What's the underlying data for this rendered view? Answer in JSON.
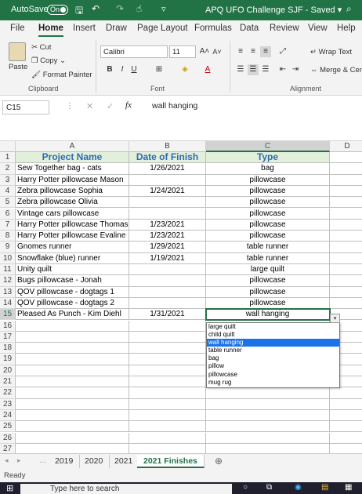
{
  "title_bar": {
    "autosave_label": "AutoSave",
    "autosave_state": "On",
    "doc_title": "APQ UFO Challenge SJF  -  Saved  ▾"
  },
  "menu": [
    "File",
    "Home",
    "Insert",
    "Draw",
    "Page Layout",
    "Formulas",
    "Data",
    "Review",
    "View",
    "Help"
  ],
  "ribbon": {
    "paste": "Paste",
    "cut": "Cut",
    "copy": "Copy",
    "format_painter": "Format Painter",
    "font_name": "Calibri",
    "font_size": "11",
    "wrap_text": "Wrap Text",
    "merge_center": "Merge & Cen",
    "groups": {
      "clipboard": "Clipboard",
      "font": "Font",
      "alignment": "Alignment"
    }
  },
  "formula_bar": {
    "name_box": "C15",
    "fx": "fx",
    "value": "wall hanging"
  },
  "columns": [
    "A",
    "B",
    "C",
    "D"
  ],
  "headers": {
    "project": "Project Name",
    "date": "Date of Finish",
    "type": "Type"
  },
  "rows": [
    {
      "n": "2",
      "a": "Sew Together bag - cats",
      "b": "1/26/2021",
      "c": "bag"
    },
    {
      "n": "3",
      "a": "Harry Potter pillowcase Mason",
      "b": "",
      "c": "pillowcase"
    },
    {
      "n": "4",
      "a": "Zebra pillowcase Sophia",
      "b": "1/24/2021",
      "c": "pillowcase"
    },
    {
      "n": "5",
      "a": "Zebra pillowcase Olivia",
      "b": "",
      "c": "pillowcase"
    },
    {
      "n": "6",
      "a": "Vintage cars pillowcase",
      "b": "",
      "c": "pillowcase"
    },
    {
      "n": "7",
      "a": "Harry Potter pillowcase Thomas",
      "b": "1/23/2021",
      "c": "pillowcase"
    },
    {
      "n": "8",
      "a": "Harry Potter pillowcase Evaline",
      "b": "1/23/2021",
      "c": "pillowcase"
    },
    {
      "n": "9",
      "a": "Gnomes runner",
      "b": "1/29/2021",
      "c": "table runner"
    },
    {
      "n": "10",
      "a": "Snowflake (blue) runner",
      "b": "1/19/2021",
      "c": "table runner"
    },
    {
      "n": "11",
      "a": "Unity quilt",
      "b": "",
      "c": "large quilt"
    },
    {
      "n": "12",
      "a": "Bugs pillowcase - Jonah",
      "b": "",
      "c": "pillowcase"
    },
    {
      "n": "13",
      "a": "QOV pillowcase - dogtags 1",
      "b": "",
      "c": "pillowcase"
    },
    {
      "n": "14",
      "a": "QOV pillowcase - dogtags 2",
      "b": "",
      "c": "pillowcase"
    },
    {
      "n": "15",
      "a": "Pleased As Punch - Kim Diehl",
      "b": "1/31/2021",
      "c": "wall hanging"
    }
  ],
  "empty_rows": [
    "16",
    "17",
    "18",
    "19",
    "20",
    "21",
    "22",
    "23",
    "24",
    "25",
    "26",
    "27"
  ],
  "dropdown_options": [
    "large quilt",
    "child quilt",
    "wall hanging",
    "table runner",
    "bag",
    "pillow",
    "pillowcase",
    "mug rug"
  ],
  "dropdown_selected": "wall hanging",
  "sheet_tabs": [
    "2019",
    "2020",
    "2021",
    "2021 Finishes"
  ],
  "active_tab": "2021 Finishes",
  "status": "Ready",
  "taskbar": {
    "search_placeholder": "Type here to search"
  },
  "colors": {
    "excel_green": "#217346",
    "header_fill": "#e2efda",
    "header_text": "#2f6ab2",
    "selection_blue": "#1a73e8"
  }
}
